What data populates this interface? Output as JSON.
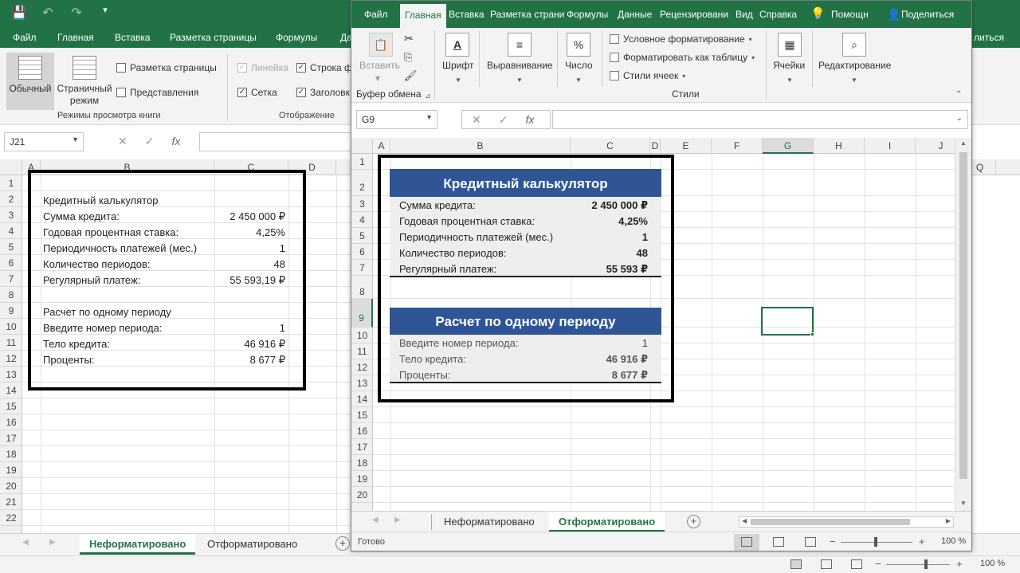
{
  "back": {
    "qat": {
      "save": "💾",
      "undo": "↶",
      "redo": "↷",
      "more": "▾"
    },
    "tabs": [
      "Файл",
      "Главная",
      "Вставка",
      "Разметка страницы",
      "Формулы",
      "Да"
    ],
    "right_tab": "литься",
    "ribbon": {
      "normal": "Обычный",
      "page_break": "Страничный режим",
      "page_layout": "Разметка страницы",
      "custom_views": "Представления",
      "group1": "Режимы просмотра книги",
      "ruler": "Линейка",
      "gridlines": "Сетка",
      "formula_bar": "Строка ф",
      "headings": "Заголовк",
      "group2": "Отображение"
    },
    "name_box": "J21",
    "col_headers": [
      "A",
      "B",
      "C",
      "D"
    ],
    "col_extra": "Q",
    "rows": [
      "1",
      "2",
      "3",
      "4",
      "5",
      "6",
      "7",
      "8",
      "9",
      "10",
      "11",
      "12",
      "13",
      "14",
      "15",
      "16",
      "17",
      "18",
      "19",
      "20",
      "21",
      "22"
    ],
    "cells": {
      "title": "Кредитный калькулятор",
      "l3": "Сумма кредита:",
      "v3": "2 450 000 ₽",
      "l4": "Годовая процентная ставка:",
      "v4": "4,25%",
      "l5": "Периодичность платежей (мес.)",
      "v5": "1",
      "l6": "Количество периодов:",
      "v6": "48",
      "l7": "Регулярный платеж:",
      "v7": "55 593,19 ₽",
      "title2": "Расчет по одному периоду",
      "l10": "Введите номер периода:",
      "v10": "1",
      "l11": "Тело кредита:",
      "v11": "46 916 ₽",
      "l12": "Проценты:",
      "v12": "8 677 ₽"
    },
    "sheets": [
      "Неформатировано",
      "Отформатировано"
    ],
    "zoom": "100 %"
  },
  "front": {
    "tabs": [
      "Файл",
      "Главная",
      "Вставка",
      "Разметка страни",
      "Формулы",
      "Данные",
      "Рецензировани",
      "Вид",
      "Справка"
    ],
    "help": "Помощн",
    "share": "Поделиться",
    "ribbon": {
      "paste": "Вставить",
      "clipboard": "Буфер обмена",
      "font": "Шрифт",
      "alignment": "Выравнивание",
      "number": "Число",
      "cond_format": "Условное форматирование",
      "format_table": "Форматировать как таблицу",
      "cell_styles": "Стили ячеек",
      "styles_group": "Стили",
      "cells": "Ячейки",
      "editing": "Редактирование"
    },
    "name_box": "G9",
    "col_headers": [
      "A",
      "B",
      "C",
      "D",
      "E",
      "F",
      "G",
      "H",
      "I",
      "J"
    ],
    "rows": [
      "1",
      "2",
      "3",
      "4",
      "5",
      "6",
      "7",
      "8",
      "9",
      "10",
      "11",
      "12",
      "13",
      "14",
      "15",
      "16",
      "17",
      "18",
      "19",
      "20"
    ],
    "calc": {
      "title": "Кредитный калькулятор",
      "l3": "Сумма кредита:",
      "v3": "2 450 000 ₽",
      "l4": "Годовая процентная ставка:",
      "v4": "4,25%",
      "l5": "Периодичность платежей (мес.)",
      "v5": "1",
      "l6": "Количество периодов:",
      "v6": "48",
      "l7": "Регулярный платеж:",
      "v7": "55 593 ₽",
      "title2": "Расчет по одному периоду",
      "l10": "Введите номер периода:",
      "v10": "1",
      "l11": "Тело кредита:",
      "v11": "46 916 ₽",
      "l12": "Проценты:",
      "v12": "8 677 ₽"
    },
    "sheets": [
      "Неформатировано",
      "Отформатировано"
    ],
    "status": "Готово",
    "zoom": "100 %"
  },
  "colors": {
    "excel_green": "#217346",
    "header_blue": "#2f5597"
  }
}
